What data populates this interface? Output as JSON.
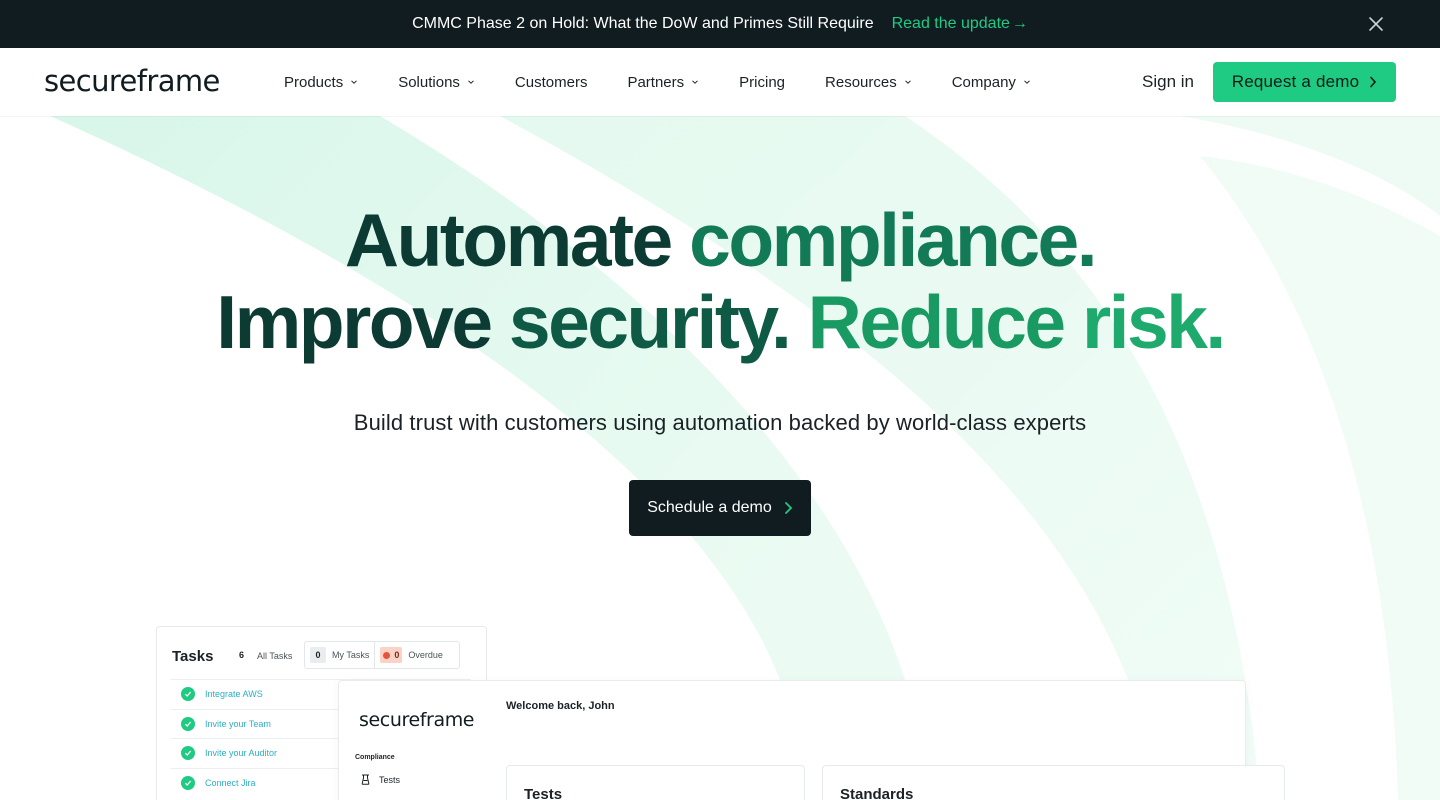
{
  "announcement": {
    "text": "CMMC Phase 2 on Hold: What the DoW and Primes Still Require",
    "link_label": "Read the update",
    "link_arrow": "→"
  },
  "nav": {
    "logo": "secureframe",
    "items": [
      {
        "label": "Products",
        "dropdown": true
      },
      {
        "label": "Solutions",
        "dropdown": true
      },
      {
        "label": "Customers",
        "dropdown": false
      },
      {
        "label": "Partners",
        "dropdown": true
      },
      {
        "label": "Pricing",
        "dropdown": false
      },
      {
        "label": "Resources",
        "dropdown": true
      },
      {
        "label": "Company",
        "dropdown": true
      }
    ],
    "sign_in": "Sign in",
    "request_demo": "Request a demo"
  },
  "hero": {
    "title_line1_a": "Automate",
    "title_line1_b": "compliance.",
    "title_line2_a": "Improve",
    "title_line2_b": "security.",
    "title_line2_c": "Reduce",
    "title_line2_d": "risk.",
    "subtitle": "Build trust with customers using automation backed by world-class experts",
    "cta": "Schedule a demo"
  },
  "tasks_card": {
    "title": "Tasks",
    "all_count": "6",
    "all_label": "All Tasks",
    "my_count": "0",
    "my_label": "My Tasks",
    "overdue_count": "0",
    "overdue_label": "Overdue",
    "tasks": [
      "Integrate AWS",
      "Invite your Team",
      "Invite your Auditor",
      "Connect Jira"
    ]
  },
  "dashboard": {
    "logo": "secureframe",
    "section": "Compliance",
    "nav_item": "Tests",
    "welcome": "Welcome back, John",
    "panels": [
      "Tests",
      "Standards"
    ]
  },
  "colors": {
    "brand_green": "#1fcb83",
    "dark": "#111c21",
    "title_dark": "#0c3b33",
    "title_mid": "#137a57",
    "title_bright": "#1eaa6d"
  }
}
